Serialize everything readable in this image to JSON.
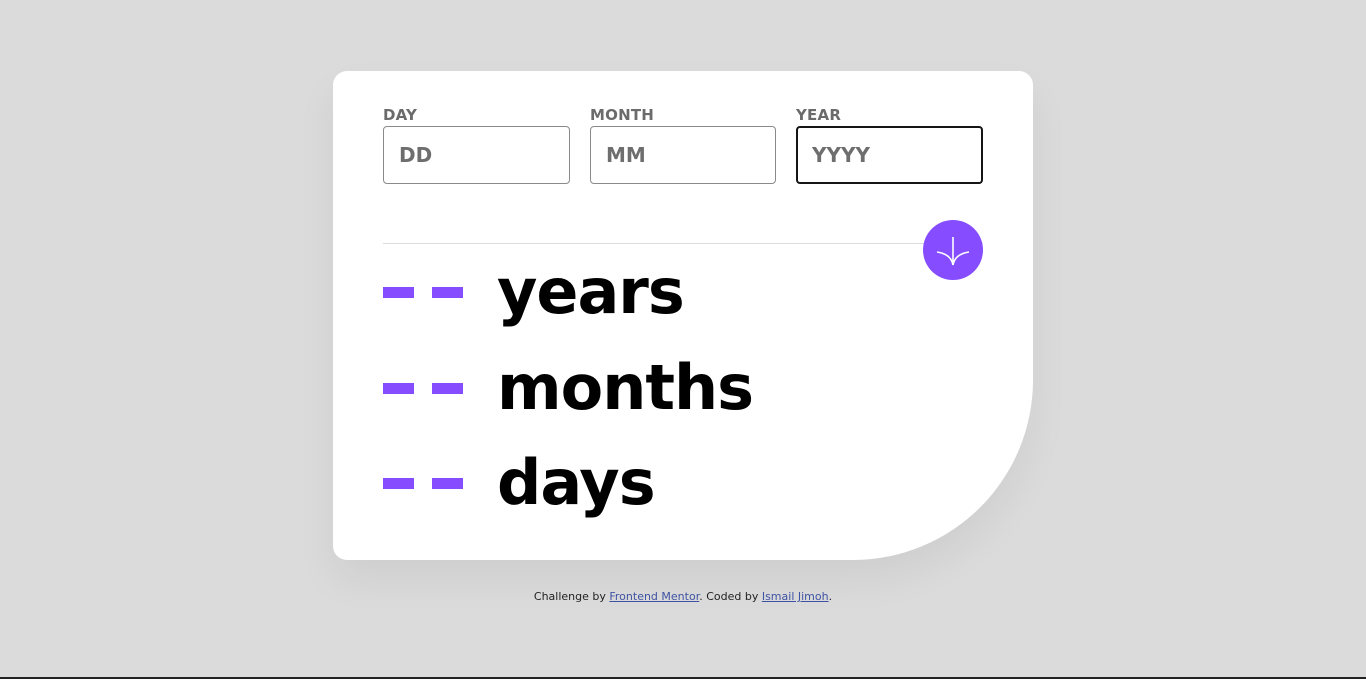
{
  "form": {
    "day": {
      "label": "DAY",
      "placeholder": "DD",
      "value": ""
    },
    "month": {
      "label": "MONTH",
      "placeholder": "MM",
      "value": ""
    },
    "year": {
      "label": "YEAR",
      "placeholder": "YYYY",
      "value": ""
    },
    "submit_icon": "arrow-down-icon"
  },
  "results": {
    "years": {
      "value": "- -",
      "unit": "years"
    },
    "months": {
      "value": "- -",
      "unit": "months"
    },
    "days": {
      "value": "- -",
      "unit": "days"
    }
  },
  "attribution": {
    "prefix": "Challenge by ",
    "link1": "Frontend Mentor",
    "middle": ". Coded by ",
    "link2": "Ismail Jimoh",
    "suffix": "."
  },
  "colors": {
    "accent": "#854dff",
    "background": "#dbdbdb",
    "card": "#ffffff",
    "text": "#000000",
    "label": "#6b6b6b"
  }
}
